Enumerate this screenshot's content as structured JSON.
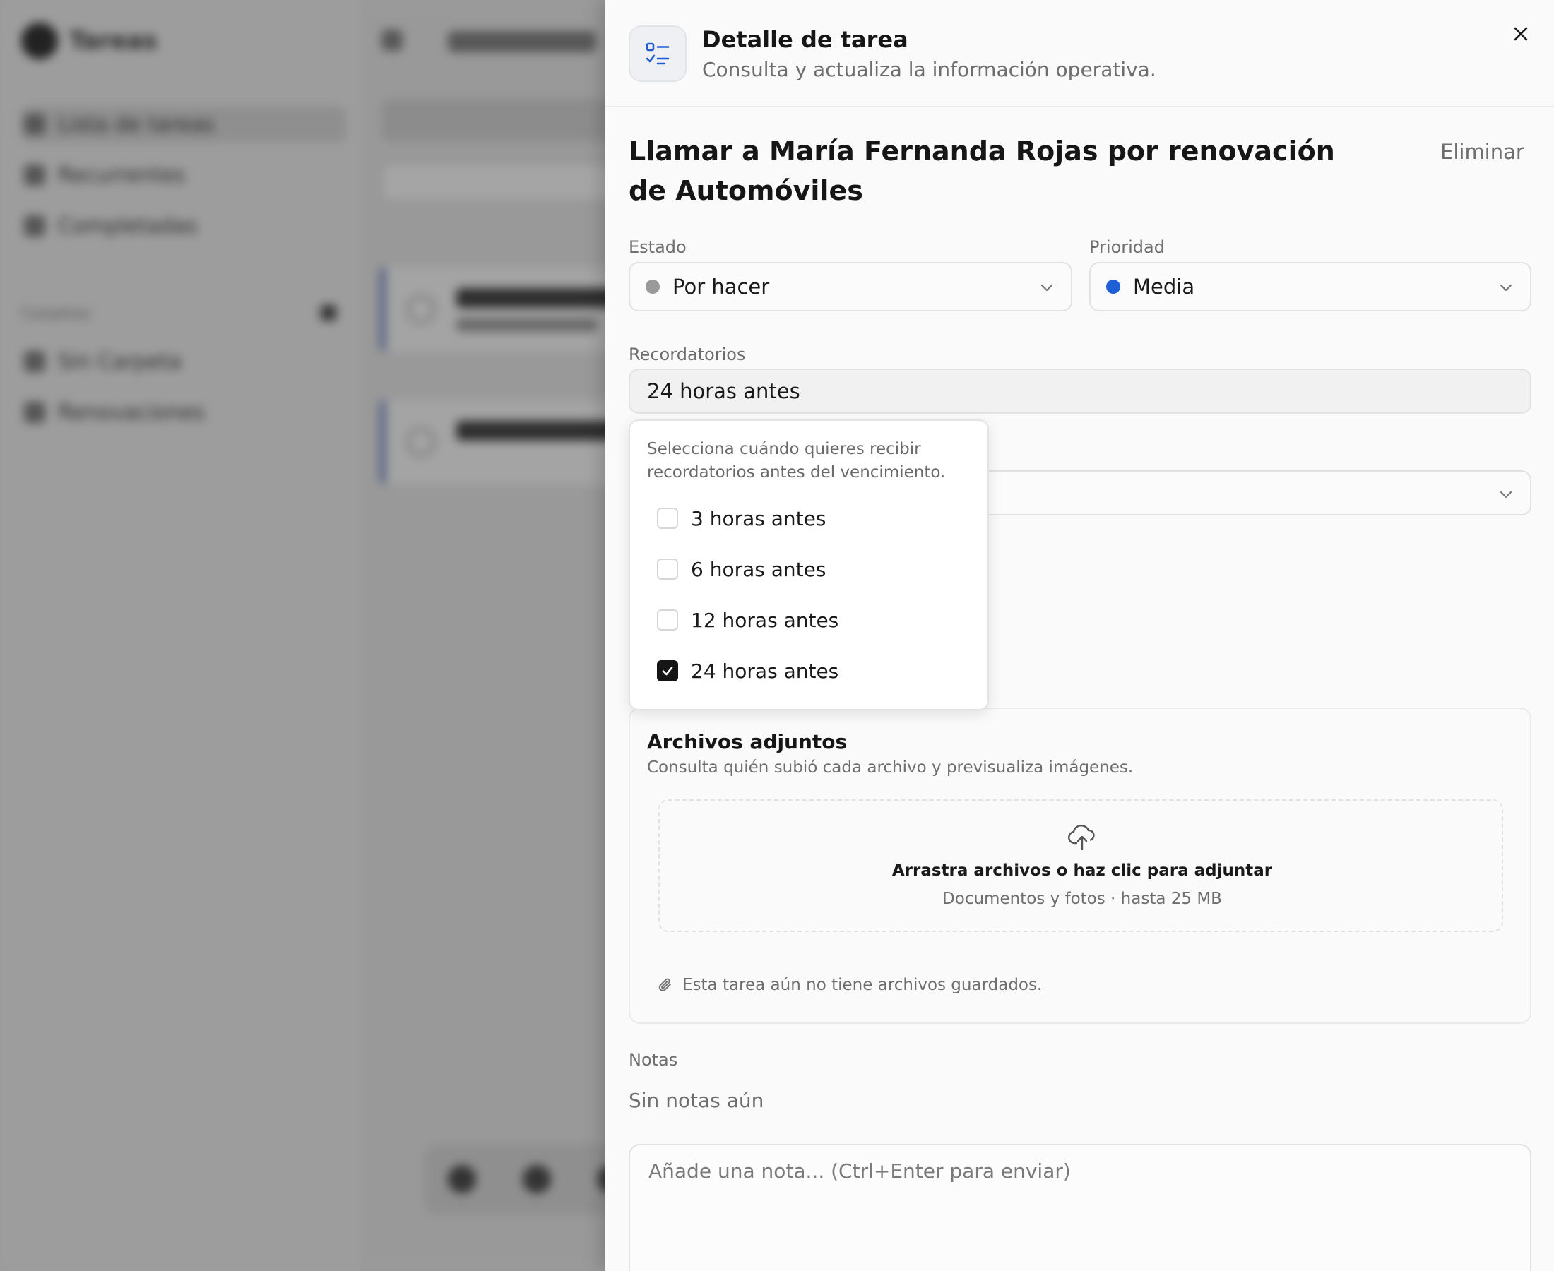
{
  "background": {
    "app_name": "Tareas",
    "nav": [
      "Lista de tareas",
      "Recurrentes",
      "Completadas"
    ],
    "section": "Carpetas",
    "folders": [
      "Sin Carpeta",
      "Renovaciones"
    ]
  },
  "drawer": {
    "title": "Detalle de tarea",
    "subtitle": "Consulta y actualiza la información operativa.",
    "close_label": "×",
    "task_title": "Llamar a María Fernanda Rojas por renovación de Automóviles",
    "delete_label": "Eliminar"
  },
  "status": {
    "label": "Estado",
    "value": "Por hacer",
    "dot_color": "#9a9a9a"
  },
  "priority": {
    "label": "Prioridad",
    "value": "Media",
    "dot_color": "#1f5fd6"
  },
  "reminders": {
    "label": "Recordatorios",
    "value": "24 horas antes",
    "description": "Selecciona cuándo quieres recibir recordatorios antes del vencimiento.",
    "options": [
      {
        "label": "3 horas antes",
        "checked": false
      },
      {
        "label": "6 horas antes",
        "checked": false
      },
      {
        "label": "12 horas antes",
        "checked": false
      },
      {
        "label": "24 horas antes",
        "checked": true
      }
    ]
  },
  "attachments": {
    "title": "Archivos adjuntos",
    "subtitle": "Consulta quién subió cada archivo y previsualiza imágenes.",
    "dropzone_main": "Arrastra archivos o haz clic para adjuntar",
    "dropzone_sub": "Documentos y fotos · hasta 25 MB",
    "empty": "Esta tarea aún no tiene archivos guardados."
  },
  "notes": {
    "label": "Notas",
    "empty": "Sin notas aún",
    "placeholder": "Añade una nota... (Ctrl+Enter para enviar)"
  },
  "colors": {
    "accent_blue": "#1f5fd6",
    "checkbox_checked": "#151515"
  }
}
